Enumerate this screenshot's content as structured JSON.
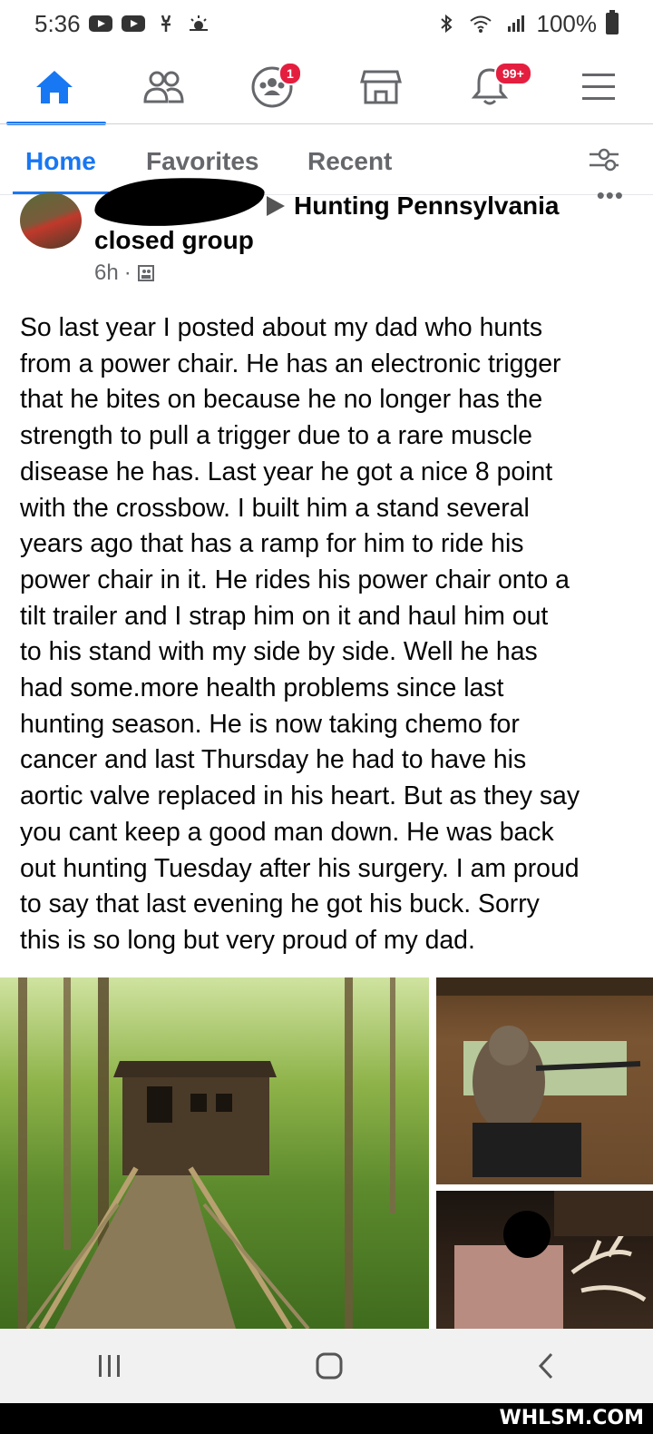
{
  "status_bar": {
    "time": "5:36",
    "battery": "100%"
  },
  "top_nav": {
    "items": [
      {
        "name": "home",
        "icon": "home-icon",
        "active": true
      },
      {
        "name": "friends",
        "icon": "friends-icon"
      },
      {
        "name": "groups",
        "icon": "groups-icon",
        "badge": "1"
      },
      {
        "name": "marketplace",
        "icon": "marketplace-icon"
      },
      {
        "name": "notifications",
        "icon": "bell-icon",
        "badge": "99+"
      },
      {
        "name": "menu",
        "icon": "hamburger-menu-icon"
      }
    ],
    "accent": "#1877f2"
  },
  "feed_tabs": {
    "tabs": [
      "Home",
      "Favorites",
      "Recent"
    ],
    "active": "Home"
  },
  "post": {
    "group_line1": "Hunting Pennsylvania",
    "group_line2": "closed group",
    "time": "6h",
    "more": "•••",
    "body": "So last year I posted about my dad who hunts\nfrom a power chair. He has an electronic trigger\nthat he bites on because he no longer has the\nstrength to pull a trigger due to a rare muscle\ndisease he has. Last year he got a nice 8 point\nwith the crossbow. I built him a stand several\nyears ago that has a ramp for him to ride his\npower chair in it. He rides his power chair onto a\ntilt trailer and I strap him on it and haul him out\nto his stand with my side by side. Well he has\nhad some.more health problems since last\nhunting season. He is now taking chemo for\ncancer and last Thursday he had to have his\naortic valve replaced in his heart. But as they say\nyou cant keep a good man down. He was back\nout hunting Tuesday after his surgery. I am proud\nto say that last evening he got his buck. Sorry\nthis is so long but very proud of my dad."
  },
  "photos": [
    {
      "id": "hunting-stand-photo"
    },
    {
      "id": "man-in-stand-photo"
    },
    {
      "id": "buck-photo"
    }
  ],
  "watermark": "WHLSM.COM"
}
